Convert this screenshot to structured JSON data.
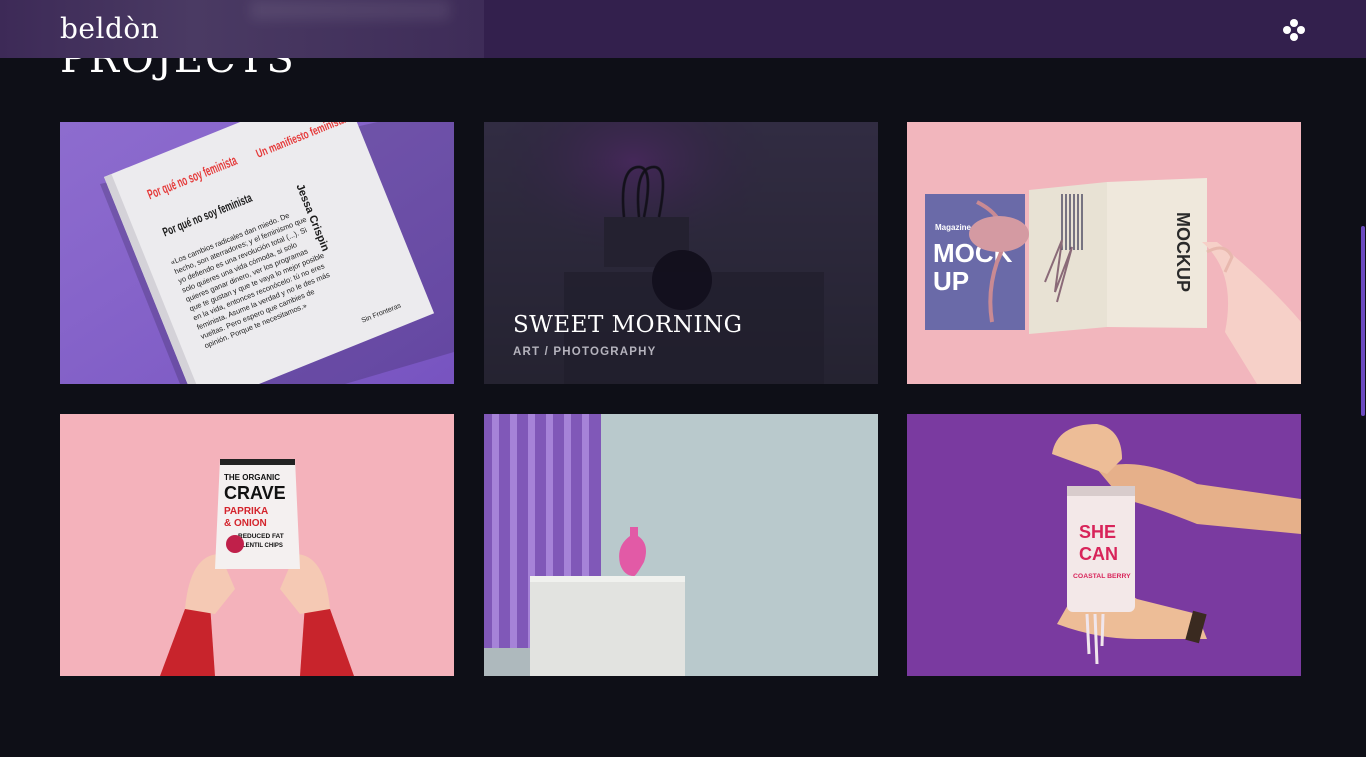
{
  "brand": {
    "logo": "beldòn"
  },
  "section": {
    "title": "PROJECTS"
  },
  "header": {
    "menu_icon": "dots-menu-icon"
  },
  "projects": [
    {
      "image": "book",
      "book_title_red": "Por qué no soy feminista",
      "book_subtitle_red": "Un manifiesto feminista",
      "book_title_black": "Por qué no soy feminista",
      "book_author": "Jessa Crispin",
      "book_publisher": "Sin Fronteras",
      "book_body": "«Los cambios radicales dan miedo. De hecho, son aterradores; y el feminismo que yo defiendo es una revolución total (...). Si solo quieres una vida cómoda, si solo quieres ganar dinero, ver los programas que te gustan y que te vaya lo mejor posible en la vida, entonces reconócelo: tú no eres feminista. Asume la verdad y no le des más vueltas. Pero espero que cambies de opinión. Porque te necesitamos.»"
    },
    {
      "title": "SWEET MORNING",
      "subtitle": "ART / PHOTOGRAPHY",
      "image": "binder-clip"
    },
    {
      "image": "magazine",
      "mag_left_small": "Magazine",
      "mag_left_big": [
        "MOCK",
        "UP"
      ],
      "mag_right_big": "MOCKUP"
    },
    {
      "image": "chips",
      "pack_line1": "THE ORGANIC",
      "pack_line2": "CRAVE",
      "pack_line3": "PAPRIKA",
      "pack_line4": "& ONION",
      "pack_line5": "REDUCED FAT",
      "pack_line6": "LENTIL CHIPS"
    },
    {
      "image": "vase"
    },
    {
      "image": "can",
      "can_line1": "SHE",
      "can_line2": "CAN",
      "can_line3": "COASTAL BERRY"
    }
  ]
}
